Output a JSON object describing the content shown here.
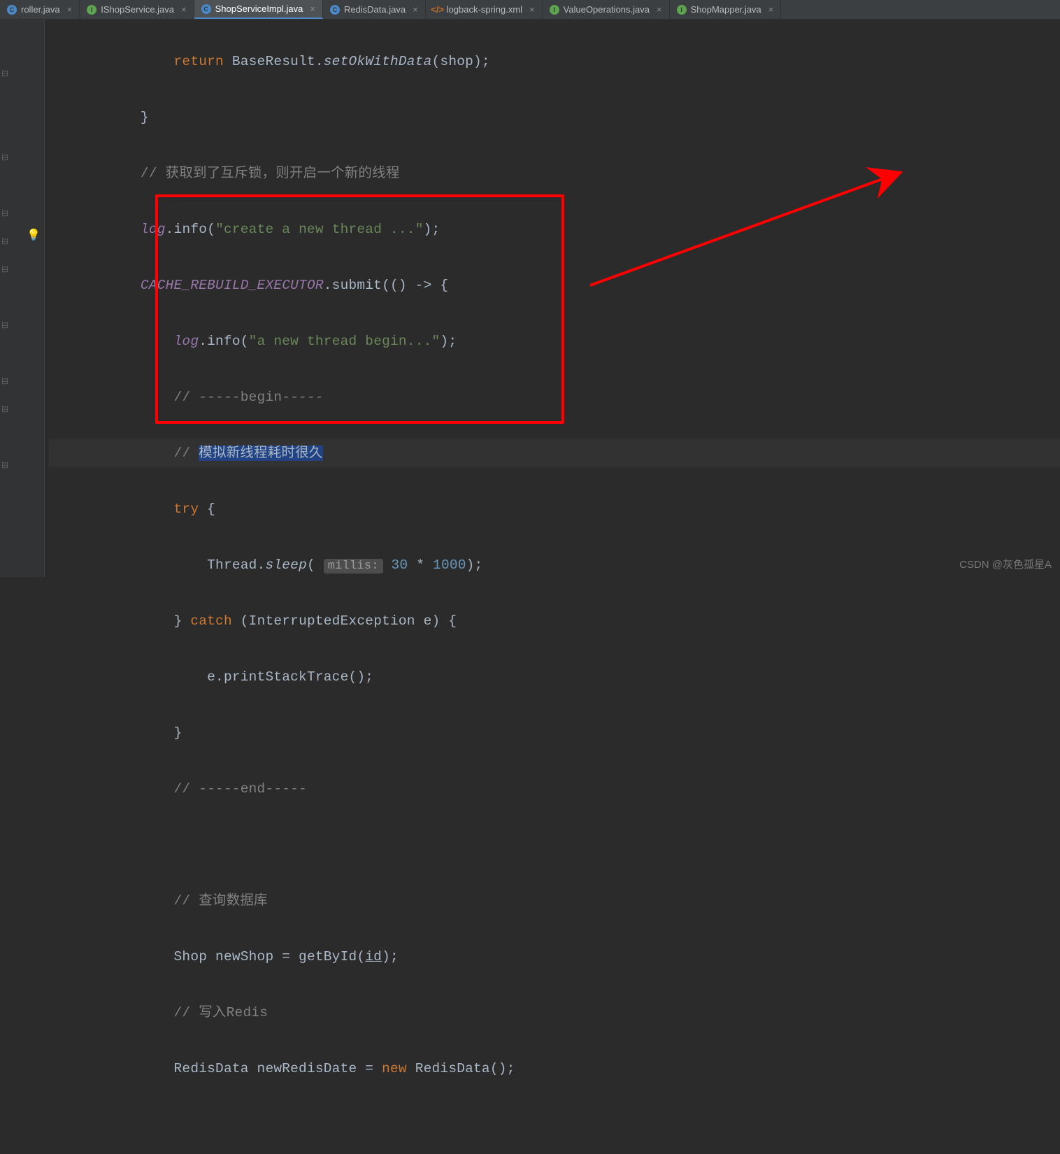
{
  "tabs": [
    {
      "label": "roller.java",
      "icon": "c"
    },
    {
      "label": "IShopService.java",
      "icon": "i"
    },
    {
      "label": "ShopServiceImpl.java",
      "icon": "c",
      "active": true
    },
    {
      "label": "RedisData.java",
      "icon": "c"
    },
    {
      "label": "logback-spring.xml",
      "icon": "xml"
    },
    {
      "label": "ValueOperations.java",
      "icon": "i"
    },
    {
      "label": "ShopMapper.java",
      "icon": "i"
    }
  ],
  "code": {
    "l1_return": "return",
    "l1_base": " BaseResult.",
    "l1_setok": "setOkWithData",
    "l1_shop": "(shop);",
    "l2_brace": "}",
    "l3_comm": "// 获取到了互斥锁，则开启一个新的线程",
    "l4_log": "log",
    "l4_info": ".info(",
    "l4_str": "\"create a new thread ...\"",
    "l4_end": ");",
    "l5_executor": "CACHE_REBUILD_EXECUTOR",
    "l5_submit": ".submit(() -> {",
    "l6_log": "log",
    "l6_info": ".info(",
    "l6_str": "\"a new thread begin...\"",
    "l6_end": ");",
    "l7_comm": "// -----begin-----",
    "l8_comm_pre": "// ",
    "l8_comm_sel": "模拟新线程耗时很久",
    "l9_try": "try",
    "l9_brace": " {",
    "l10_thread": "Thread.",
    "l10_sleep": "sleep",
    "l10_open": "( ",
    "l10_hint": "millis:",
    "l10_num1": " 30",
    "l10_op": " * ",
    "l10_num2": "1000",
    "l10_end": ");",
    "l11_brace": "} ",
    "l11_catch": "catch",
    "l11_ex": " (InterruptedException e) {",
    "l12_print": "e.printStackTrace();",
    "l13_brace": "}",
    "l14_comm": "// -----end-----",
    "l16_comm": "// 查询数据库",
    "l17_shop": "Shop newShop = getById(",
    "l17_id": "id",
    "l17_end": ");",
    "l18_comm": "// 写入Redis",
    "l19_redis": "RedisData newRedisDate = ",
    "l19_new": "new",
    "l19_ctor": " RedisData();"
  },
  "watermark": "CSDN @灰色孤星A"
}
